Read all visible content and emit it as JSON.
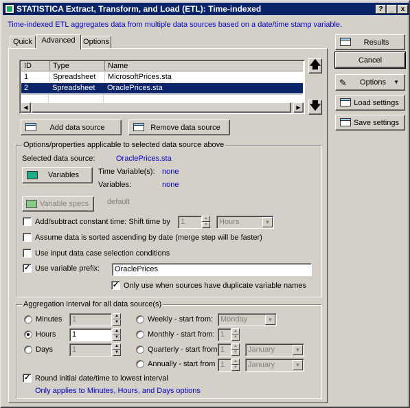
{
  "window": {
    "title": "STATISTICA Extract, Transform, and Load (ETL): Time-indexed",
    "help_btn": "?",
    "min_btn": "_",
    "close_btn": "x"
  },
  "description": "Time-indexed ETL aggregates data from multiple data sources based on a date/time stamp variable.",
  "tabs": [
    "Quick",
    "Advanced",
    "Options"
  ],
  "right_buttons": {
    "results": "Results",
    "cancel": "Cancel",
    "options": "Options",
    "load_settings": "Load settings",
    "save_settings": "Save settings"
  },
  "table": {
    "columns": [
      "ID",
      "Type",
      "Name"
    ],
    "rows": [
      {
        "id": "1",
        "type": "Spreadsheet",
        "name": "MicrosoftPrices.sta"
      },
      {
        "id": "2",
        "type": "Spreadsheet",
        "name": "OraclePrices.sta"
      }
    ]
  },
  "add_source": "Add data source",
  "remove_source": "Remove data source",
  "props": {
    "legend": "Options/properties applicable to selected data source above",
    "selected_label": "Selected data source:",
    "selected_value": "OraclePrices.sta",
    "variables_btn": "Variables",
    "time_var_label": "Time Variable(s):",
    "time_var_value": "none",
    "variables_label": "Variables:",
    "variables_value": "none",
    "variable_specs_btn": "Variable specs",
    "default_text": "default",
    "shift_label": "Add/subtract constant time: Shift time by",
    "shift_value": "1",
    "shift_unit": "Hours",
    "sorted_label": "Assume data is sorted ascending by date (merge step will be faster)",
    "case_sel_label": "Use input data case selection conditions",
    "prefix_label": "Use variable prefix:",
    "prefix_value": "OraclePrices",
    "only_dup_label": "Only use when sources have duplicate variable names"
  },
  "agg": {
    "legend": "Aggregation interval for all data source(s)",
    "minutes": "Minutes",
    "minutes_val": "1",
    "hours": "Hours",
    "hours_val": "1",
    "days": "Days",
    "days_val": "1",
    "weekly": "Weekly - start from:",
    "weekly_val": "Monday",
    "monthly": "Monthly - start from:",
    "monthly_val": "1",
    "quarterly": "Quarterly - start from",
    "quarterly_num": "1",
    "quarterly_month": "January",
    "annually": "Annually - start from",
    "annually_num": "1",
    "annually_month": "January",
    "round_label": "Round initial date/time to lowest interval",
    "round_note": "Only applies to Minutes, Hours, and Days options"
  }
}
